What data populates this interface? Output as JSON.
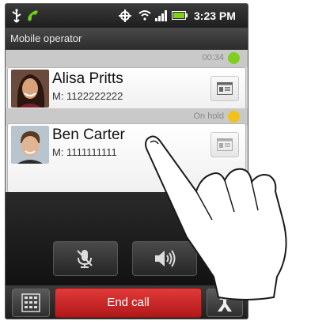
{
  "status_bar": {
    "time": "3:23 PM",
    "icons": [
      "usb-icon",
      "call-indicator-icon",
      "gps-icon",
      "wifi-icon",
      "signal-icon",
      "battery-icon"
    ]
  },
  "operator": "Mobile operator",
  "calls": [
    {
      "status": "00:34",
      "status_color": "#7fd01e",
      "name": "Alisa Pritts",
      "number": "M: 1122222222",
      "button_icon": "contact-card-icon"
    },
    {
      "status": "On hold",
      "status_color": "#f2c21a",
      "name": "Ben  Carter",
      "number": "M: 1111111111",
      "button_icon": "contact-card-icon"
    }
  ],
  "controls": {
    "mute_icon": "mute-microphone-icon",
    "speaker_icon": "speaker-icon"
  },
  "bottom_bar": {
    "end_call_label": "End call",
    "dialpad_icon": "dialpad-icon",
    "merge_icon": "merge-calls-icon"
  },
  "colors": {
    "end_call": "#d42a2a",
    "active_dot": "#7fd01e",
    "hold_dot": "#f2c21a"
  }
}
